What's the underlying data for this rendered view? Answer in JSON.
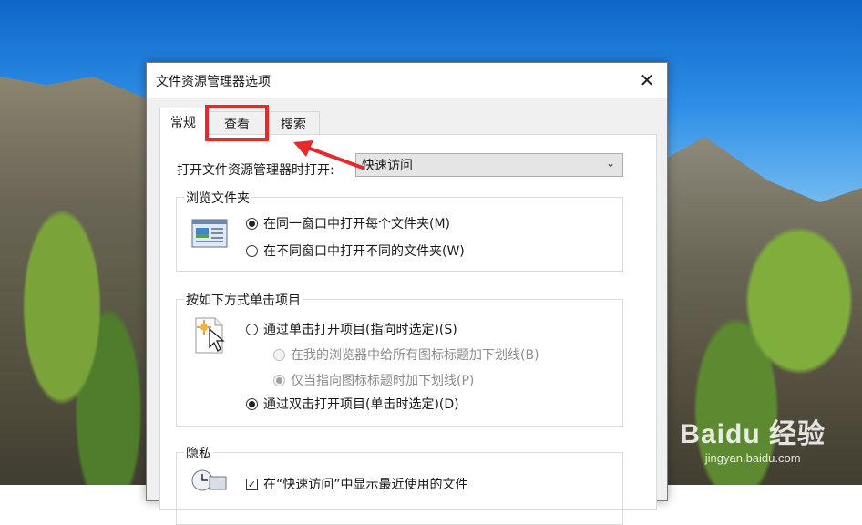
{
  "dialog": {
    "title": "文件资源管理器选项",
    "close_glyph": "✕"
  },
  "tabs": [
    {
      "label": "常规",
      "active": true
    },
    {
      "label": "查看",
      "active": false
    },
    {
      "label": "搜索",
      "active": false
    }
  ],
  "general": {
    "open_label": "打开文件资源管理器时打开:",
    "open_value": "快速访问",
    "browse": {
      "title": "浏览文件夹",
      "options": [
        {
          "label": "在同一窗口中打开每个文件夹(M)",
          "selected": true
        },
        {
          "label": "在不同窗口中打开不同的文件夹(W)",
          "selected": false
        }
      ]
    },
    "click": {
      "title": "按如下方式单击项目",
      "single": "通过单击打开项目(指向时选定)(S)",
      "sub_all": "在我的浏览器中给所有图标标题加下划线(B)",
      "sub_point": "仅当指向图标标题时加下划线(P)",
      "double": "通过双击打开项目(单击时选定)(D)"
    },
    "privacy": {
      "title": "隐私",
      "recent_files": "在“快速访问”中显示最近使用的文件"
    }
  },
  "annotation": {
    "color": "#e8282b"
  },
  "watermark": {
    "logo": "Baidu 经验",
    "url": "jingyan.baidu.com"
  }
}
